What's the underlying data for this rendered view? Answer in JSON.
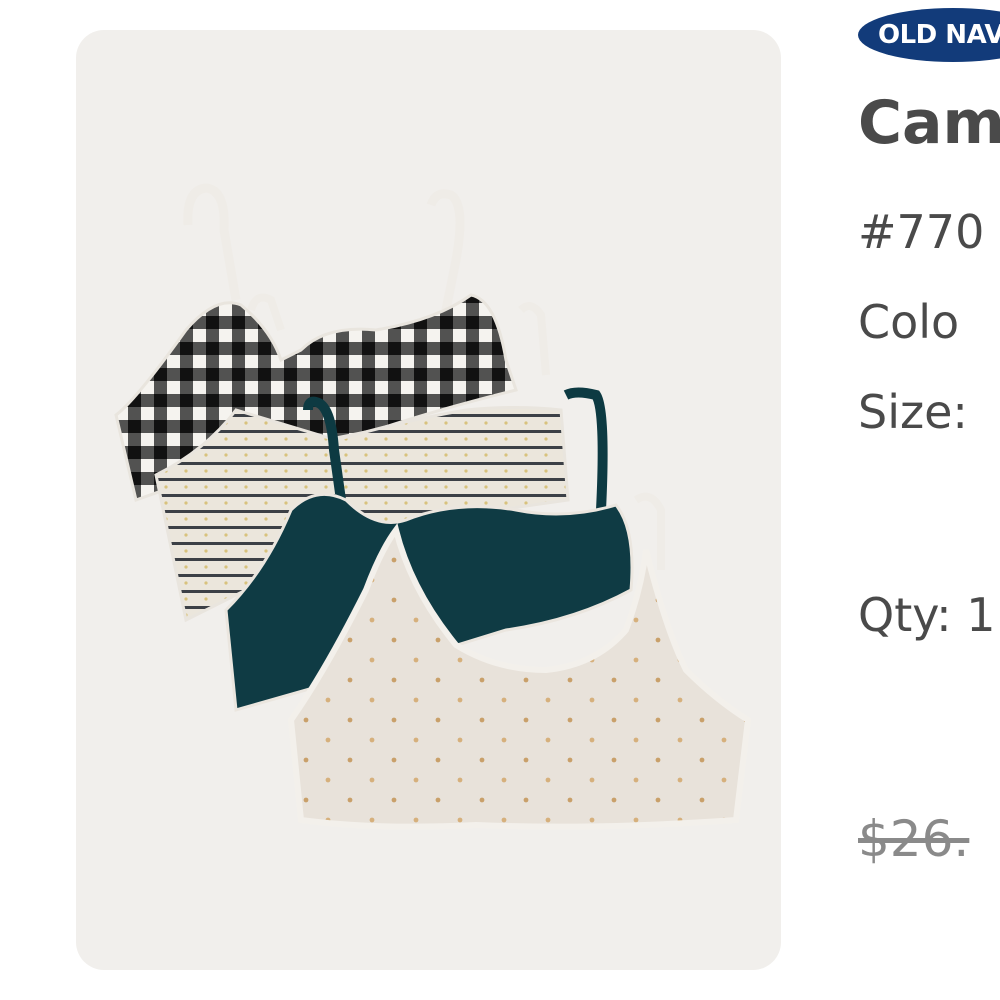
{
  "product": {
    "image_alt": "Three-pack of cami bras: black gingham, striped ivory, and dark teal with a polka-dot ivory layer",
    "brand": "OLD NAVY",
    "title": "Cam",
    "item_number": "#770",
    "color_label": "Colo",
    "size_label": "Size:",
    "qty_label": "Qty: 1",
    "original_price": "$26."
  },
  "colors": {
    "brand_blue": "#123b7a",
    "text": "#4a4a4a",
    "strike_price": "#8a8a8a",
    "card_bg": "#f1efec"
  }
}
